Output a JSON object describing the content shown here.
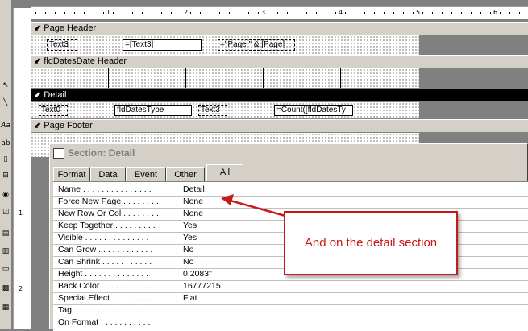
{
  "ruler": {
    "marks": [
      "1",
      "2",
      "3",
      "4",
      "5",
      "6"
    ],
    "vmarks": [
      "1",
      "2"
    ]
  },
  "sections": {
    "page_header": "Page Header",
    "group_header": "fldDatesDate Header",
    "detail": "Detail",
    "page_footer": "Page Footer"
  },
  "controls": {
    "ph_label": "Text3",
    "ph_text3": "=[Text3]",
    "ph_page": "=\"Page \" & [Page]",
    "d_label": "Text0",
    "d_type": "fldDatesType",
    "d_text3": "Text3",
    "d_count": "=Count([fldDatesTy"
  },
  "property_sheet": {
    "title": "Section: Detail",
    "tabs": [
      "Format",
      "Data",
      "Event",
      "Other",
      "All"
    ],
    "active_tab": "All",
    "rows": [
      {
        "name": "Name . . . . . . . . . . . . . . .",
        "value": "Detail"
      },
      {
        "name": "Force New Page . . . . . . . .",
        "value": "None"
      },
      {
        "name": "New Row Or Col . . . . . . . .",
        "value": "None"
      },
      {
        "name": "Keep Together . . . . . . . . .",
        "value": "Yes"
      },
      {
        "name": "Visible . . . . . . . . . . . . . .",
        "value": "Yes"
      },
      {
        "name": "Can Grow . . . . . . . . . . . .",
        "value": "No"
      },
      {
        "name": "Can Shrink . . . . . . . . . . .",
        "value": "No"
      },
      {
        "name": "Height . . . . . . . . . . . . . .",
        "value": "0.2083\""
      },
      {
        "name": "Back Color . . . . . . . . . . .",
        "value": "16777215"
      },
      {
        "name": "Special Effect . . . . . . . . .",
        "value": "Flat"
      },
      {
        "name": "Tag . . . . . . . . . . . . . . . .",
        "value": ""
      },
      {
        "name": "On Format . . . . . . . . . . .",
        "value": ""
      }
    ]
  },
  "callout": {
    "text": "And on the detail section"
  },
  "colors": {
    "callout": "#c81818",
    "selected_bar": "#000000"
  }
}
